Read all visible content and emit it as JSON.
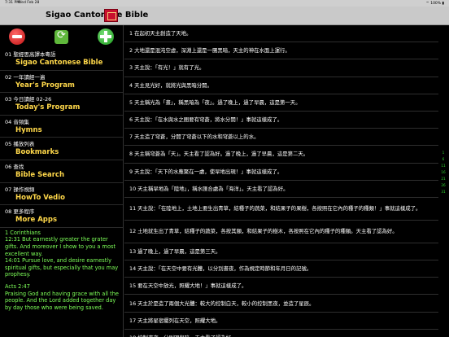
{
  "status": {
    "time": "7:31 PM",
    "date": "Wed Feb 28",
    "battery": "100%"
  },
  "app": {
    "title": "Sigao Cantonese Bible"
  },
  "menu": [
    {
      "zh": "01 聖經思高譯本粵語",
      "en": "Sigao Cantonese Bible"
    },
    {
      "zh": "02 一年讀經一遍",
      "en": "Year's Program"
    },
    {
      "zh": "03 今日讀經  02-26",
      "en": "Today's Program"
    },
    {
      "zh": "04 音頻集",
      "en": "Hymns"
    },
    {
      "zh": "05 播放列表",
      "en": "Bookmarks"
    },
    {
      "zh": "06 查找",
      "en": "Bible Search"
    },
    {
      "zh": "07 操作視頻",
      "en": "HowTo Vedio"
    },
    {
      "zh": "08 更多程序",
      "en": "More Apps"
    }
  ],
  "daily_verses": {
    "ref1": "1 Corinthians",
    "text1": "12:31 But earnestly greater the grater gifts. And moreover I show to you a most excellent  way.",
    "text1b": "14:01 Pursue love, and desire earnestly spiritual gifts, but especially that you may prophesy.",
    "ref2": "Acts 2:47",
    "text2": "Praising God and having grace with all the people. And the Lord added together day by day those who were being saved."
  },
  "verses": [
    "1 在起初天主創造了天地。",
    "2 大地還是混沌空虛，深淵上還是一團黑暗，天主的神在水面上運行。",
    "3 天主說：「有光！」就有了光。",
    "4 天主見光好，就將光與黑暗分開。",
    "5 天主稱光為「晝」，稱黑暗為「夜」。過了晚上，過了早晨，這是第一天。",
    "6 天主說：「在水與水之間要有穹蒼，將水分開！」事就這樣成了。",
    "7 天主造了穹蒼，分開了穹蒼以下的水和穹蒼以上的水。",
    "8 天主稱穹蒼為「天」。天主看了認為好。過了晚上，過了早晨，這是第二天。",
    "9 天主說：「天下的水應聚在一處，使旱地出現！」事就這樣成了。",
    "10 天主稱旱地為「陸地」，稱水匯合處為「海洋」。天主看了認為好。",
    "11 天主說：「在陸地上，土地上要生出青草，結種子的蔬菜，和結果子的果樹，各按照在它內的種子的種類！」事就這樣成了。",
    "12 土地就生出了青草，結種子的蔬菜，各按其類，和結果子的樹木，各按照在它內的種子的種類。天主看了認為好。",
    "13 過了晚上，過了早晨，這是第三天。",
    "14 天主說：「在天空中要有光體，以分別晝夜，作為規定時節和年月日的記號。",
    "15 要在天空中放光，照耀大地！」事就這樣成了。",
    "16 天主於是造了兩個大光體：較大的控制白天，較小的控制黑夜，並造了星辰。",
    "17 天主將星宿擺列在天空，照耀大地。",
    "18 控制晝夜，分別明與暗。天主看了認為好。"
  ],
  "verse_lines": [
    2,
    2,
    2,
    2,
    2,
    2,
    2,
    2,
    2,
    2,
    3,
    3,
    2,
    2,
    2,
    2,
    2,
    2
  ],
  "index": [
    "1",
    "6",
    "11",
    "16",
    "21",
    "26",
    "31"
  ]
}
